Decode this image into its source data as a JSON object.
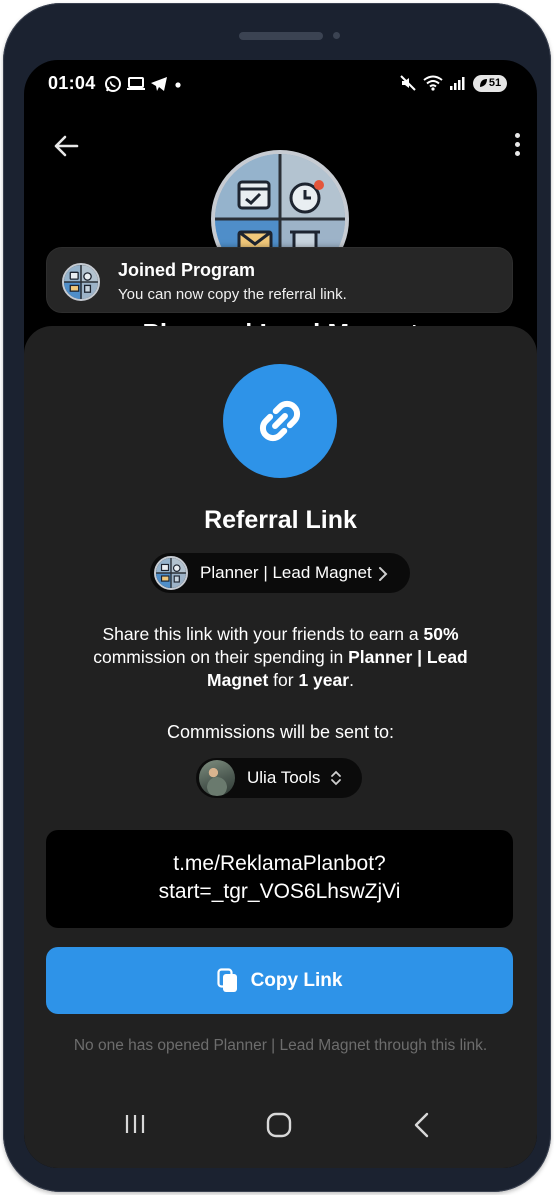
{
  "status_bar": {
    "time": "01:04",
    "battery": "51"
  },
  "header": {
    "bot_title": "Planner | Lead Magnet"
  },
  "toast": {
    "title": "Joined Program",
    "message": "You can now copy the referral link."
  },
  "sheet": {
    "title": "Referral Link",
    "bot_chip_label": "Planner | Lead Magnet",
    "description": {
      "part1": "Share this link with your friends to earn a ",
      "percent": "50%",
      "part2": " commission on their spending in ",
      "bot_name": "Planner | Lead Magnet",
      "part3": " for ",
      "duration": "1 year",
      "part4": "."
    },
    "commission_label": "Commissions will be sent to:",
    "recipient_name": "Ulia Tools",
    "link_line1": "t.me/ReklamaPlanbot?",
    "link_line2": "start=_tgr_VOS6LhswZjVi",
    "copy_button_label": "Copy Link",
    "footnote": "No one has opened Planner | Lead Magnet through this link."
  },
  "colors": {
    "accent": "#2e93e8",
    "sheet_bg": "#212121",
    "screen_bg": "#000000"
  }
}
